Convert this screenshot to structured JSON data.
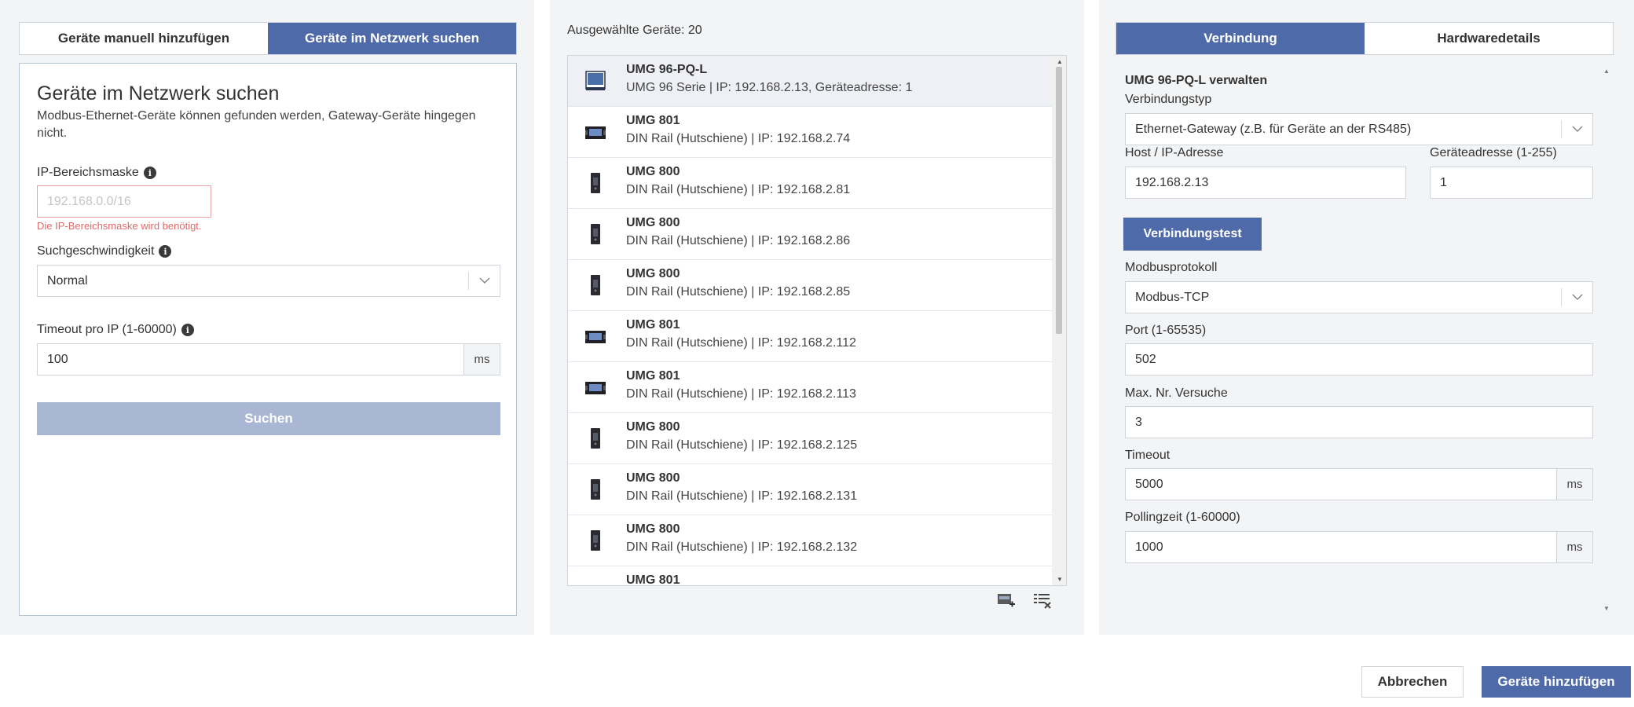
{
  "left": {
    "tabs": [
      {
        "label": "Geräte manuell hinzufügen",
        "active": false
      },
      {
        "label": "Geräte im Netzwerk suchen",
        "active": true
      }
    ],
    "title": "Geräte im Netzwerk suchen",
    "description": "Modbus-Ethernet-Geräte können gefunden werden, Gateway-Geräte hingegen nicht.",
    "ip_mask": {
      "label": "IP-Bereichsmaske",
      "placeholder": "192.168.0.0/16",
      "error": "Die IP-Bereichsmaske wird benötigt."
    },
    "search_speed": {
      "label": "Suchgeschwindigkeit",
      "value": "Normal"
    },
    "timeout": {
      "label": "Timeout pro IP (1-60000)",
      "value": "100",
      "unit": "ms"
    },
    "search_button": "Suchen"
  },
  "middle": {
    "selected_label": "Ausgewählte Geräte: 20",
    "devices": [
      {
        "name": "UMG 96-PQ-L",
        "detail": "UMG 96 Serie | IP: 192.168.2.13, Geräteadresse: 1",
        "icon": "umg96-device-icon",
        "selected": true
      },
      {
        "name": "UMG 801",
        "detail": "DIN Rail (Hutschiene) | IP: 192.168.2.74",
        "icon": "din-rail-wide-device-icon"
      },
      {
        "name": "UMG 800",
        "detail": "DIN Rail (Hutschiene) | IP: 192.168.2.81",
        "icon": "din-rail-narrow-device-icon"
      },
      {
        "name": "UMG 800",
        "detail": "DIN Rail (Hutschiene) | IP: 192.168.2.86",
        "icon": "din-rail-narrow-device-icon"
      },
      {
        "name": "UMG 800",
        "detail": "DIN Rail (Hutschiene) | IP: 192.168.2.85",
        "icon": "din-rail-narrow-device-icon"
      },
      {
        "name": "UMG 801",
        "detail": "DIN Rail (Hutschiene) | IP: 192.168.2.112",
        "icon": "din-rail-wide-device-icon"
      },
      {
        "name": "UMG 801",
        "detail": "DIN Rail (Hutschiene) | IP: 192.168.2.113",
        "icon": "din-rail-wide-device-icon"
      },
      {
        "name": "UMG 800",
        "detail": "DIN Rail (Hutschiene) | IP: 192.168.2.125",
        "icon": "din-rail-narrow-device-icon"
      },
      {
        "name": "UMG 800",
        "detail": "DIN Rail (Hutschiene) | IP: 192.168.2.131",
        "icon": "din-rail-narrow-device-icon"
      },
      {
        "name": "UMG 800",
        "detail": "DIN Rail (Hutschiene) | IP: 192.168.2.132",
        "icon": "din-rail-narrow-device-icon"
      },
      {
        "name": "UMG 801",
        "detail": "",
        "icon": "din-rail-wide-device-icon"
      }
    ],
    "actions": [
      "add-selection-icon",
      "clear-list-icon"
    ]
  },
  "right": {
    "tabs": [
      {
        "label": "Verbindung",
        "active": true
      },
      {
        "label": "Hardwaredetails",
        "active": false
      }
    ],
    "manage_title": "UMG 96-PQ-L verwalten",
    "connection_type": {
      "label": "Verbindungstyp",
      "value": "Ethernet-Gateway (z.B. für Geräte an der RS485)"
    },
    "host": {
      "label": "Host / IP-Adresse",
      "value": "192.168.2.13"
    },
    "device_address": {
      "label": "Geräteadresse (1-255)",
      "value": "1"
    },
    "test_button": "Verbindungstest",
    "modbus_protocol": {
      "label": "Modbusprotokoll",
      "value": "Modbus-TCP"
    },
    "port": {
      "label": "Port (1-65535)",
      "value": "502"
    },
    "max_attempts": {
      "label": "Max. Nr. Versuche",
      "value": "3"
    },
    "timeout": {
      "label": "Timeout",
      "value": "5000",
      "unit": "ms"
    },
    "polling": {
      "label": "Pollingzeit (1-60000)",
      "value": "1000",
      "unit": "ms"
    }
  },
  "footer": {
    "cancel": "Abbrechen",
    "add_devices": "Geräte hinzufügen"
  },
  "colors": {
    "primary": "#4f6aa8",
    "primary_disabled": "#a9b7d4",
    "error": "#e06a6a",
    "panel_bg": "#f3f4f6"
  }
}
